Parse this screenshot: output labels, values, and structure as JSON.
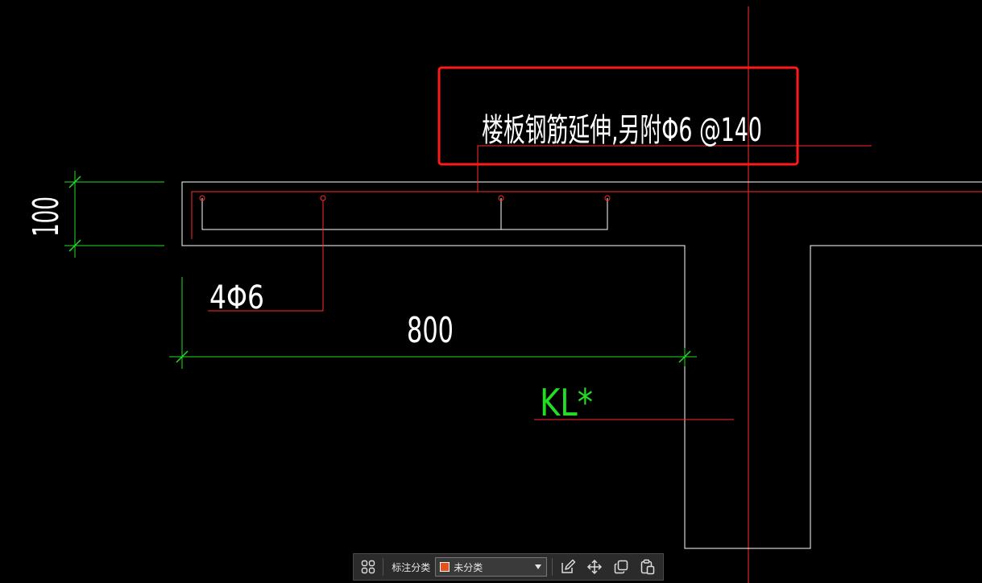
{
  "drawing": {
    "note_text": "楼板钢筋延伸,另附Φ6 @140",
    "rebar_label": "4Φ6",
    "span_dimension": "800",
    "thickness_dimension": "100",
    "beam_label": "KL*"
  },
  "toolbar": {
    "label": "标注分类",
    "selected_category": "未分类",
    "swatch_color": "#e8501c"
  },
  "colors": {
    "background": "#000000",
    "outline": "#ffffff",
    "rebar_red": "#ff2a2a",
    "dimension_green": "#22dd22",
    "highlight_box": "#ff1a1a"
  },
  "icons": {
    "toolbar_grid": "grid-icon",
    "toolbar_edit": "edit-icon",
    "toolbar_move": "move-icon",
    "toolbar_copy": "copy-icon",
    "toolbar_paste": "paste-icon"
  }
}
